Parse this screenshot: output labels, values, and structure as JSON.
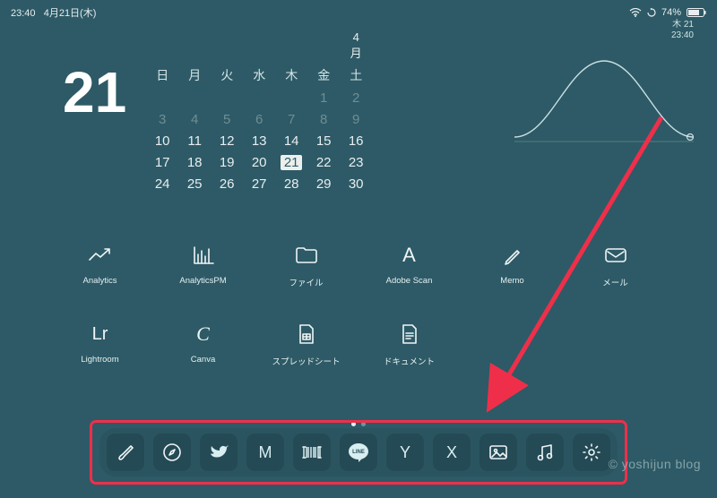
{
  "status": {
    "time": "23:40",
    "date": "4月21日(木)",
    "battery": "74%"
  },
  "clock_widget": {
    "line1": "木 21",
    "line2": "23:40"
  },
  "calendar": {
    "big_day": "21",
    "month_label": "4月",
    "weekdays": [
      "日",
      "月",
      "火",
      "水",
      "木",
      "金",
      "土"
    ],
    "weeks": [
      [
        {
          "n": "",
          "p": true
        },
        {
          "n": "",
          "p": true
        },
        {
          "n": "",
          "p": true
        },
        {
          "n": "",
          "p": true
        },
        {
          "n": "",
          "p": true
        },
        {
          "n": "1",
          "p": true
        },
        {
          "n": "2",
          "p": true
        }
      ],
      [
        {
          "n": "3",
          "p": true
        },
        {
          "n": "4",
          "p": true
        },
        {
          "n": "5",
          "p": true
        },
        {
          "n": "6",
          "p": true
        },
        {
          "n": "7",
          "p": true
        },
        {
          "n": "8",
          "p": true
        },
        {
          "n": "9",
          "p": true
        }
      ],
      [
        {
          "n": "10"
        },
        {
          "n": "11"
        },
        {
          "n": "12"
        },
        {
          "n": "13"
        },
        {
          "n": "14"
        },
        {
          "n": "15"
        },
        {
          "n": "16"
        }
      ],
      [
        {
          "n": "17"
        },
        {
          "n": "18"
        },
        {
          "n": "19"
        },
        {
          "n": "20"
        },
        {
          "n": "21",
          "t": true
        },
        {
          "n": "22"
        },
        {
          "n": "23"
        }
      ],
      [
        {
          "n": "24"
        },
        {
          "n": "25"
        },
        {
          "n": "26"
        },
        {
          "n": "27"
        },
        {
          "n": "28"
        },
        {
          "n": "29"
        },
        {
          "n": "30"
        }
      ]
    ]
  },
  "apps_row1": [
    {
      "id": "analytics",
      "label": "Analytics",
      "icon": "trend-up-icon"
    },
    {
      "id": "analyticspm",
      "label": "AnalyticsPM",
      "icon": "bar-chart-icon"
    },
    {
      "id": "files",
      "label": "ファイル",
      "icon": "folder-icon"
    },
    {
      "id": "adobescan",
      "label": "Adobe Scan",
      "icon": "letter-a-icon"
    },
    {
      "id": "memo",
      "label": "Memo",
      "icon": "pencil-icon"
    },
    {
      "id": "mail",
      "label": "メール",
      "icon": "envelope-icon"
    }
  ],
  "apps_row2": [
    {
      "id": "lightroom",
      "label": "Lightroom",
      "icon": "lr-text-icon",
      "text": "Lr"
    },
    {
      "id": "canva",
      "label": "Canva",
      "icon": "c-script-icon",
      "text": "C"
    },
    {
      "id": "sheets",
      "label": "スプレッドシート",
      "icon": "sheet-icon"
    },
    {
      "id": "docs",
      "label": "ドキュメント",
      "icon": "doc-icon"
    }
  ],
  "dock": [
    {
      "id": "brush",
      "icon": "brush-icon"
    },
    {
      "id": "safari",
      "icon": "compass-icon"
    },
    {
      "id": "twitter",
      "icon": "twitter-icon"
    },
    {
      "id": "gmail",
      "icon": "letter-m-icon",
      "text": "M"
    },
    {
      "id": "barcode",
      "icon": "barcode-icon"
    },
    {
      "id": "line",
      "icon": "line-icon",
      "text": "LINE"
    },
    {
      "id": "yahoo",
      "icon": "letter-y-icon",
      "text": "Y"
    },
    {
      "id": "x",
      "icon": "letter-x-icon",
      "text": "X"
    },
    {
      "id": "photos",
      "icon": "image-icon"
    },
    {
      "id": "music",
      "icon": "music-icon"
    },
    {
      "id": "settings",
      "icon": "gear-icon"
    }
  ],
  "page_dots": {
    "count": 2,
    "active": 0
  },
  "watermark": "© yoshijun blog",
  "annotation": {
    "color": "#ef2f4a"
  }
}
